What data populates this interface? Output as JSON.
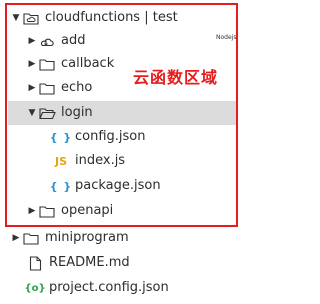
{
  "tree": {
    "root": {
      "label": "cloudfunctions | test"
    },
    "items": [
      {
        "label": "add"
      },
      {
        "label": "callback"
      },
      {
        "label": "echo"
      },
      {
        "label": "login"
      },
      {
        "label": "config.json",
        "icon_text": "{ }"
      },
      {
        "label": "index.js",
        "icon_text": "JS"
      },
      {
        "label": "package.json",
        "icon_text": "{ }"
      },
      {
        "label": "openapi"
      }
    ],
    "outside": [
      {
        "label": "miniprogram"
      },
      {
        "label": "README.md"
      },
      {
        "label": "project.config.json",
        "icon_text": "{o}"
      }
    ]
  },
  "annotation": {
    "text": "云函数区域"
  },
  "tag": {
    "text": "Nodejs"
  },
  "colors": {
    "highlight": "#e41d1d",
    "json_icon": "#2a8fd6",
    "js_icon": "#e7a21b",
    "project_icon": "#2aa34a"
  }
}
